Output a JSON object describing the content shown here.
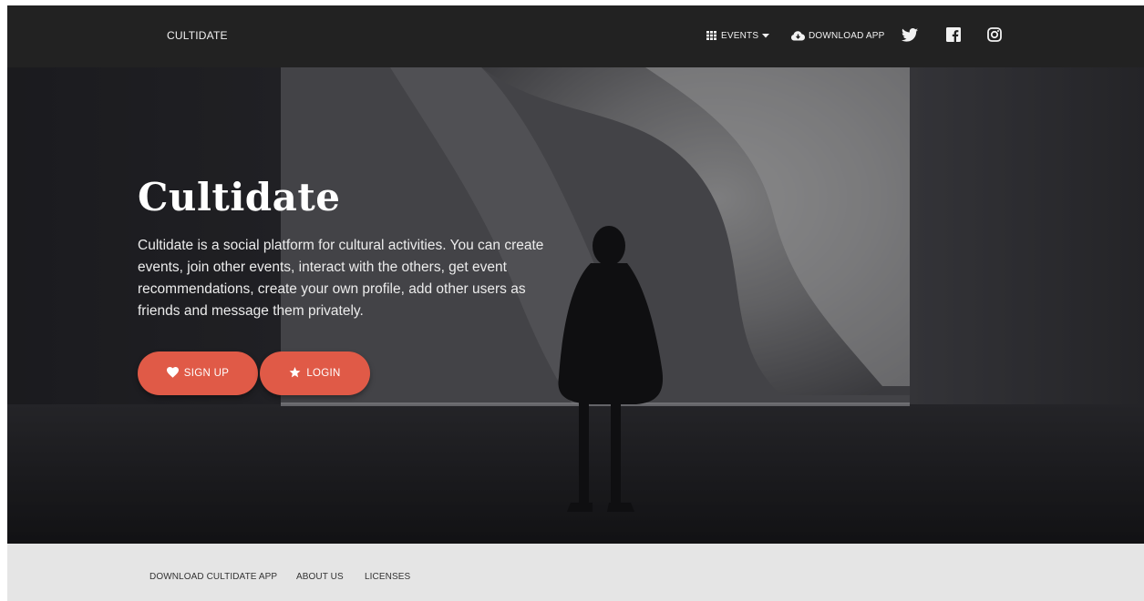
{
  "navbar": {
    "brand": "CULTIDATE",
    "events_label": "EVENTS",
    "download_label": "DOWNLOAD APP",
    "social": [
      "twitter-icon",
      "facebook-icon",
      "instagram-icon"
    ]
  },
  "hero": {
    "title": "Cultidate",
    "description": "Cultidate is a social platform for cultural activities. You can create events, join other events, interact with the others, get event recommendations, create your own profile, add other users as friends and message them privately.",
    "signup_label": "SIGN UP",
    "login_label": "LOGIN"
  },
  "footer": {
    "links": [
      "DOWNLOAD CULTIDATE APP",
      "ABOUT US",
      "LICENSES"
    ]
  },
  "colors": {
    "navbar": "#222222",
    "accent": "#e05a47",
    "footer": "#e5e5e5"
  }
}
